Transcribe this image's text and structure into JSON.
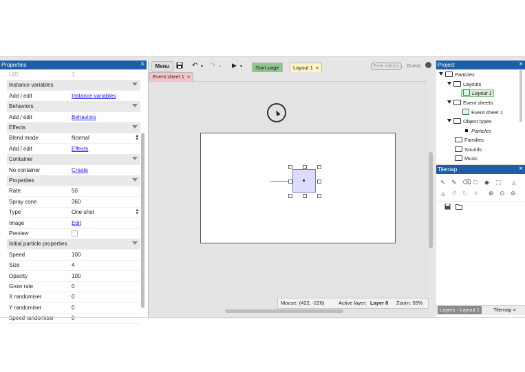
{
  "properties": {
    "title": "Properties",
    "close": "×",
    "rows": [
      {
        "type": "row",
        "key": "UID",
        "value": "1"
      },
      {
        "type": "section",
        "key": "Instance variables"
      },
      {
        "type": "row",
        "key": "Add / edit",
        "value": "Instance variables",
        "link": true
      },
      {
        "type": "section",
        "key": "Behaviors"
      },
      {
        "type": "row",
        "key": "Add / edit",
        "value": "Behaviors",
        "link": true
      },
      {
        "type": "section",
        "key": "Effects"
      },
      {
        "type": "row",
        "key": "Blend mode",
        "value": "Normal",
        "select": true
      },
      {
        "type": "row",
        "key": "Add / edit",
        "value": "Effects",
        "link": true
      },
      {
        "type": "section",
        "key": "Container"
      },
      {
        "type": "row",
        "key": "No container",
        "value": "Create",
        "link": true
      },
      {
        "type": "section",
        "key": "Properties"
      },
      {
        "type": "row",
        "key": "Rate",
        "value": "50"
      },
      {
        "type": "row",
        "key": "Spray cone",
        "value": "360"
      },
      {
        "type": "row",
        "key": "Type",
        "value": "One-shot",
        "select": true
      },
      {
        "type": "row",
        "key": "Image",
        "value": "Edit",
        "link": true
      },
      {
        "type": "row",
        "key": "Preview",
        "value": "",
        "checkbox": true
      },
      {
        "type": "section",
        "key": "Initial particle properties"
      },
      {
        "type": "row",
        "key": "Speed",
        "value": "100"
      },
      {
        "type": "row",
        "key": "Size",
        "value": "4"
      },
      {
        "type": "row",
        "key": "Opacity",
        "value": "100"
      },
      {
        "type": "row",
        "key": "Grow rate",
        "value": "0"
      },
      {
        "type": "row",
        "key": "X randomiser",
        "value": "0"
      },
      {
        "type": "row",
        "key": "Y randomiser",
        "value": "0"
      },
      {
        "type": "row",
        "key": "Speed randomiser",
        "value": "0"
      }
    ]
  },
  "toolbar": {
    "menu": "Menu",
    "save_icon": "save-icon",
    "undo_icon": "undo-icon",
    "redo_icon": "redo-icon",
    "play_icon": "play-icon",
    "free_edition": "Free edition",
    "guest": "Guest"
  },
  "tabs": {
    "start_page": "Start page",
    "layout_1": "Layout 1",
    "event_sheet_1": "Event sheet 1",
    "close": "×"
  },
  "status": {
    "mouse": "Mouse: (422, -226)",
    "active_layer_label": "Active layer:",
    "active_layer_value": "Layer 0",
    "zoom": "Zoom: 55%"
  },
  "project": {
    "title": "Project",
    "close": "×",
    "root": "Particles",
    "layouts": "Layouts",
    "layout_1": "Layout 1",
    "event_sheets": "Event sheets",
    "event_sheet_1": "Event sheet 1",
    "object_types": "Object types",
    "particles_obj": "Particles",
    "families": "Families",
    "sounds": "Sounds",
    "music": "Music"
  },
  "tilemap": {
    "title": "Tilemap",
    "close": "×",
    "layers_tab": "Layers - Layout 1",
    "tilemap_tab": "Tilemap",
    "tab_close": "×"
  },
  "colors": {
    "header_blue": "#1d5ea8",
    "link_blue": "#1a1aff",
    "sprite_fill": "#dcdcff",
    "tab_start": "#8fc48f",
    "tab_layout": "#fff3c4",
    "tab_event": "#f6c6c6"
  }
}
